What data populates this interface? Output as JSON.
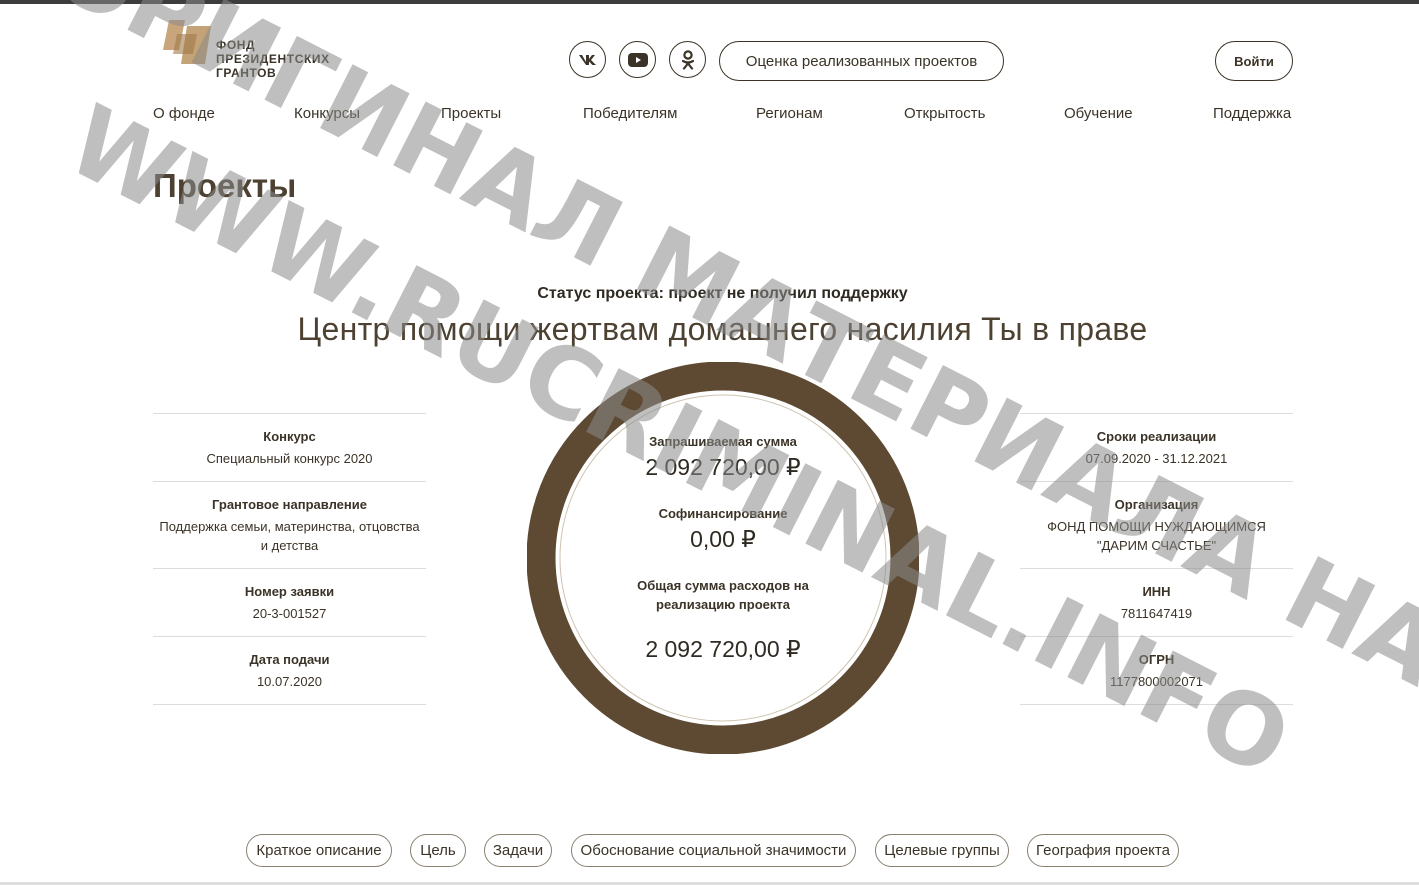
{
  "colors": {
    "accent": "#5e4a33",
    "text": "#3b3327",
    "logo_gold": "#c4a27a"
  },
  "header": {
    "logo_lines": [
      "ФОНД",
      "ПРЕЗИДЕНТСКИХ",
      "ГРАНТОВ"
    ],
    "social_icons": [
      "vk-icon",
      "youtube-icon",
      "odnoklassniki-icon"
    ],
    "eval_button": "Оценка реализованных проектов",
    "login_button": "Войти"
  },
  "nav": [
    "О фонде",
    "Конкурсы",
    "Проекты",
    "Победителям",
    "Регионам",
    "Открытость",
    "Обучение",
    "Поддержка"
  ],
  "page_title": "Проекты",
  "project": {
    "status": "Статус проекта: проект не получил поддержку",
    "name": "Центр помощи жертвам домашнего насилия Ты в праве"
  },
  "left_info": [
    {
      "label": "Конкурс",
      "value": "Специальный конкурс 2020"
    },
    {
      "label": "Грантовое направление",
      "value": "Поддержка семьи, материнства, отцовства и детства"
    },
    {
      "label": "Номер заявки",
      "value": "20-3-001527"
    },
    {
      "label": "Дата подачи",
      "value": "10.07.2020"
    }
  ],
  "right_info": [
    {
      "label": "Сроки реализации",
      "value": "07.09.2020 - 31.12.2021"
    },
    {
      "label": "Организация",
      "value": "ФОНД ПОМОЩИ НУЖДАЮЩИМСЯ \"ДАРИМ СЧАСТЬЕ\""
    },
    {
      "label": "ИНН",
      "value": "7811647419"
    },
    {
      "label": "ОГРН",
      "value": "1177800002071"
    }
  ],
  "finance": {
    "requested_label": "Запрашиваемая сумма",
    "requested_value": "2 092 720,00 ₽",
    "cofinancing_label": "Софинансирование",
    "cofinancing_value": "0,00 ₽",
    "total_label": "Общая сумма расходов на реализацию проекта",
    "total_value": "2 092 720,00 ₽"
  },
  "tabs": [
    "Краткое описание",
    "Цель",
    "Задачи",
    "Обоснование социальной значимости",
    "Целевые группы",
    "География проекта"
  ],
  "watermark": {
    "line1": "ОРИГИНАЛ МАТЕРИАЛА НА",
    "line2": "WWW.RUCRIMINAL.INFO"
  }
}
